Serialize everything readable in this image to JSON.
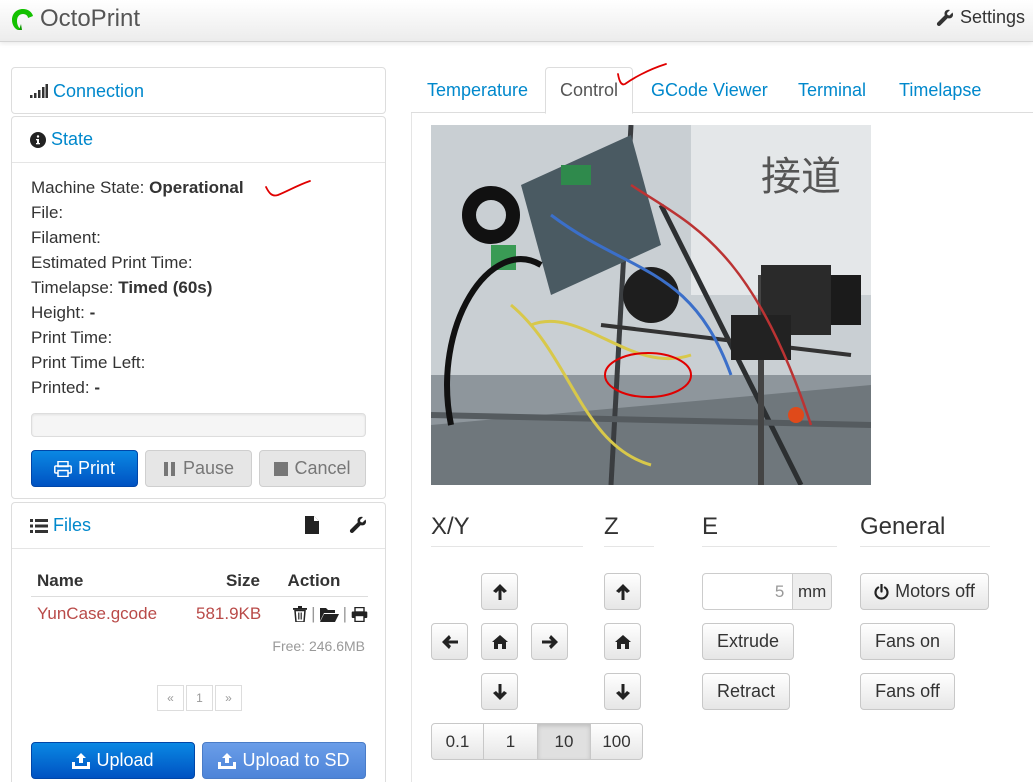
{
  "navbar": {
    "brand": "OctoPrint",
    "settings_label": "Settings"
  },
  "sidebar": {
    "connection": {
      "title": "Connection",
      "icon": "signal-icon"
    },
    "state": {
      "title": "State",
      "icon": "info-circle-icon",
      "fields": [
        {
          "label": "Machine State:",
          "value": "Operational"
        },
        {
          "label": "File:",
          "value": ""
        },
        {
          "label": "Filament:",
          "value": ""
        },
        {
          "label": "Estimated Print Time:",
          "value": ""
        },
        {
          "label": "Timelapse:",
          "value": "Timed (60s)"
        },
        {
          "label": "Height:",
          "value": "-"
        },
        {
          "label": "Print Time:",
          "value": ""
        },
        {
          "label": "Print Time Left:",
          "value": ""
        },
        {
          "label": "Printed:",
          "value": "-"
        }
      ],
      "buttons": {
        "print": "Print",
        "pause": "Pause",
        "cancel": "Cancel"
      }
    },
    "files": {
      "title": "Files",
      "columns": {
        "name": "Name",
        "size": "Size",
        "action": "Action"
      },
      "rows": [
        {
          "name": "YunCase.gcode",
          "size": "581.9KB"
        }
      ],
      "free": "Free: 246.6MB",
      "pagination": {
        "prev": "«",
        "page": "1",
        "next": "»"
      },
      "upload": "Upload",
      "upload_sd": "Upload to SD"
    }
  },
  "tabs": [
    {
      "label": "Temperature",
      "active": false
    },
    {
      "label": "Control",
      "active": true
    },
    {
      "label": "GCode Viewer",
      "active": false
    },
    {
      "label": "Terminal",
      "active": false
    },
    {
      "label": "Timelapse",
      "active": false
    }
  ],
  "control": {
    "sections": {
      "xy": "X/Y",
      "z": "Z",
      "e": "E",
      "general": "General"
    },
    "step_sizes": [
      "0.1",
      "1",
      "10",
      "100"
    ],
    "active_step": "10",
    "extrude_amount": "5",
    "extrude_unit": "mm",
    "extrude": "Extrude",
    "retract": "Retract",
    "motors_off": "Motors off",
    "fans_on": "Fans on",
    "fans_off": "Fans off"
  },
  "colors": {
    "link": "#0088cc",
    "primary": "#0060d0",
    "file_name": "#b94a48",
    "annotation": "#e00000"
  }
}
